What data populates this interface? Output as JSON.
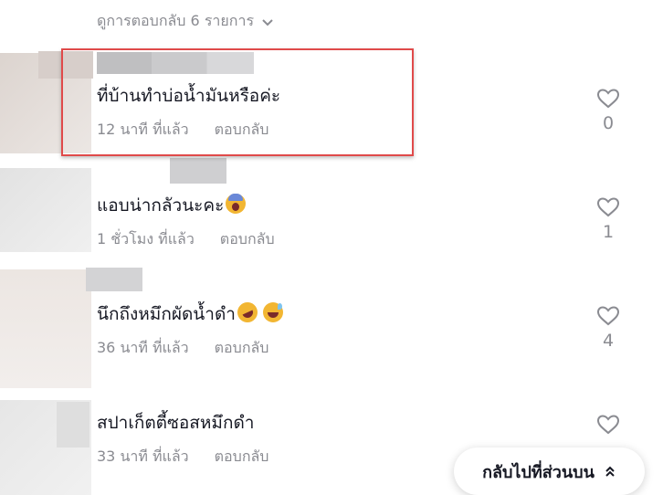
{
  "replies_toggle": {
    "label": "ดูการตอบกลับ 6 รายการ",
    "icon": "chevron-down-icon"
  },
  "comments": [
    {
      "text": "ที่บ้านทำบ่อน้ำมันหรือค่ะ",
      "emojis": [],
      "time": "12 นาที ที่แล้ว",
      "reply_label": "ตอบกลับ",
      "likes": "0",
      "highlighted": true
    },
    {
      "text": "แอบน่ากลัวนะคะ",
      "emojis": [
        "face-screaming-emoji"
      ],
      "time": "1 ชั่วโมง ที่แล้ว",
      "reply_label": "ตอบกลับ",
      "likes": "1",
      "highlighted": false
    },
    {
      "text": "นึกถึงหมึกผัดน้ำดำ",
      "emojis": [
        "rolling-laughing-emoji",
        "grinning-sweat-emoji"
      ],
      "time": "36 นาที ที่แล้ว",
      "reply_label": "ตอบกลับ",
      "likes": "4",
      "highlighted": false
    },
    {
      "text": "สปาเก็ตตี้ซอสหมึกดำ",
      "emojis": [],
      "time": "33 นาที ที่แล้ว",
      "reply_label": "ตอบกลับ",
      "likes": "",
      "highlighted": false
    }
  ],
  "back_to_top": {
    "label": "กลับไปที่ส่วนบน",
    "icon": "double-chevron-up-icon"
  },
  "colors": {
    "text": "#161823",
    "muted": "#8a8b91",
    "highlight_border": "#e04a4a"
  }
}
